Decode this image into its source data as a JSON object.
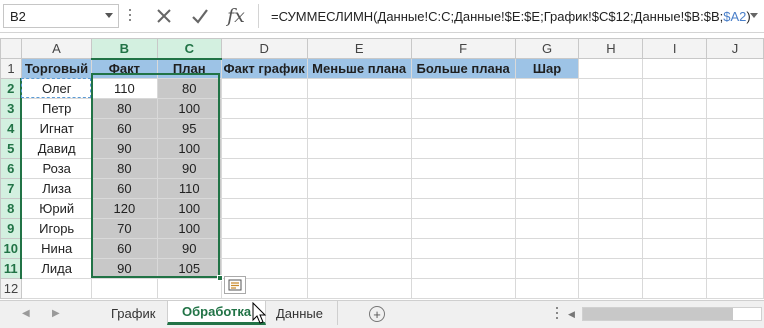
{
  "formula_bar": {
    "name_box": "B2",
    "formula_main": "=СУММЕСЛИМН(Данные!C:C;Данные!$E:$E;График!$C$12;Данные!$B:$B;",
    "formula_ref": "$A2",
    "formula_end": ")",
    "cancel_icon": "x-icon",
    "enter_icon": "check-icon",
    "fx_label": "fx"
  },
  "columns": [
    "A",
    "B",
    "C",
    "D",
    "E",
    "F",
    "G",
    "H",
    "I",
    "J"
  ],
  "rows": [
    "1",
    "2",
    "3",
    "4",
    "5",
    "6",
    "7",
    "8",
    "9",
    "10",
    "11",
    "12"
  ],
  "header": [
    "Торговый",
    "Факт",
    "План",
    "Факт график",
    "Меньше плана",
    "Больше плана",
    "Шар"
  ],
  "data": [
    [
      "Олег",
      "110",
      "80"
    ],
    [
      "Петр",
      "80",
      "100"
    ],
    [
      "Игнат",
      "60",
      "95"
    ],
    [
      "Давид",
      "90",
      "100"
    ],
    [
      "Роза",
      "80",
      "90"
    ],
    [
      "Лиза",
      "60",
      "110"
    ],
    [
      "Юрий",
      "120",
      "100"
    ],
    [
      "Игорь",
      "70",
      "100"
    ],
    [
      "Нина",
      "60",
      "90"
    ],
    [
      "Лида",
      "90",
      "105"
    ]
  ],
  "tabs": [
    "График",
    "Обработка",
    "Данные"
  ],
  "active_tab": "Обработка",
  "colors": {
    "header_fill": "#9dc3e6",
    "gray_fill": "#c8c8c8",
    "excel_green": "#217346",
    "ref_blue": "#4a7fc9"
  }
}
